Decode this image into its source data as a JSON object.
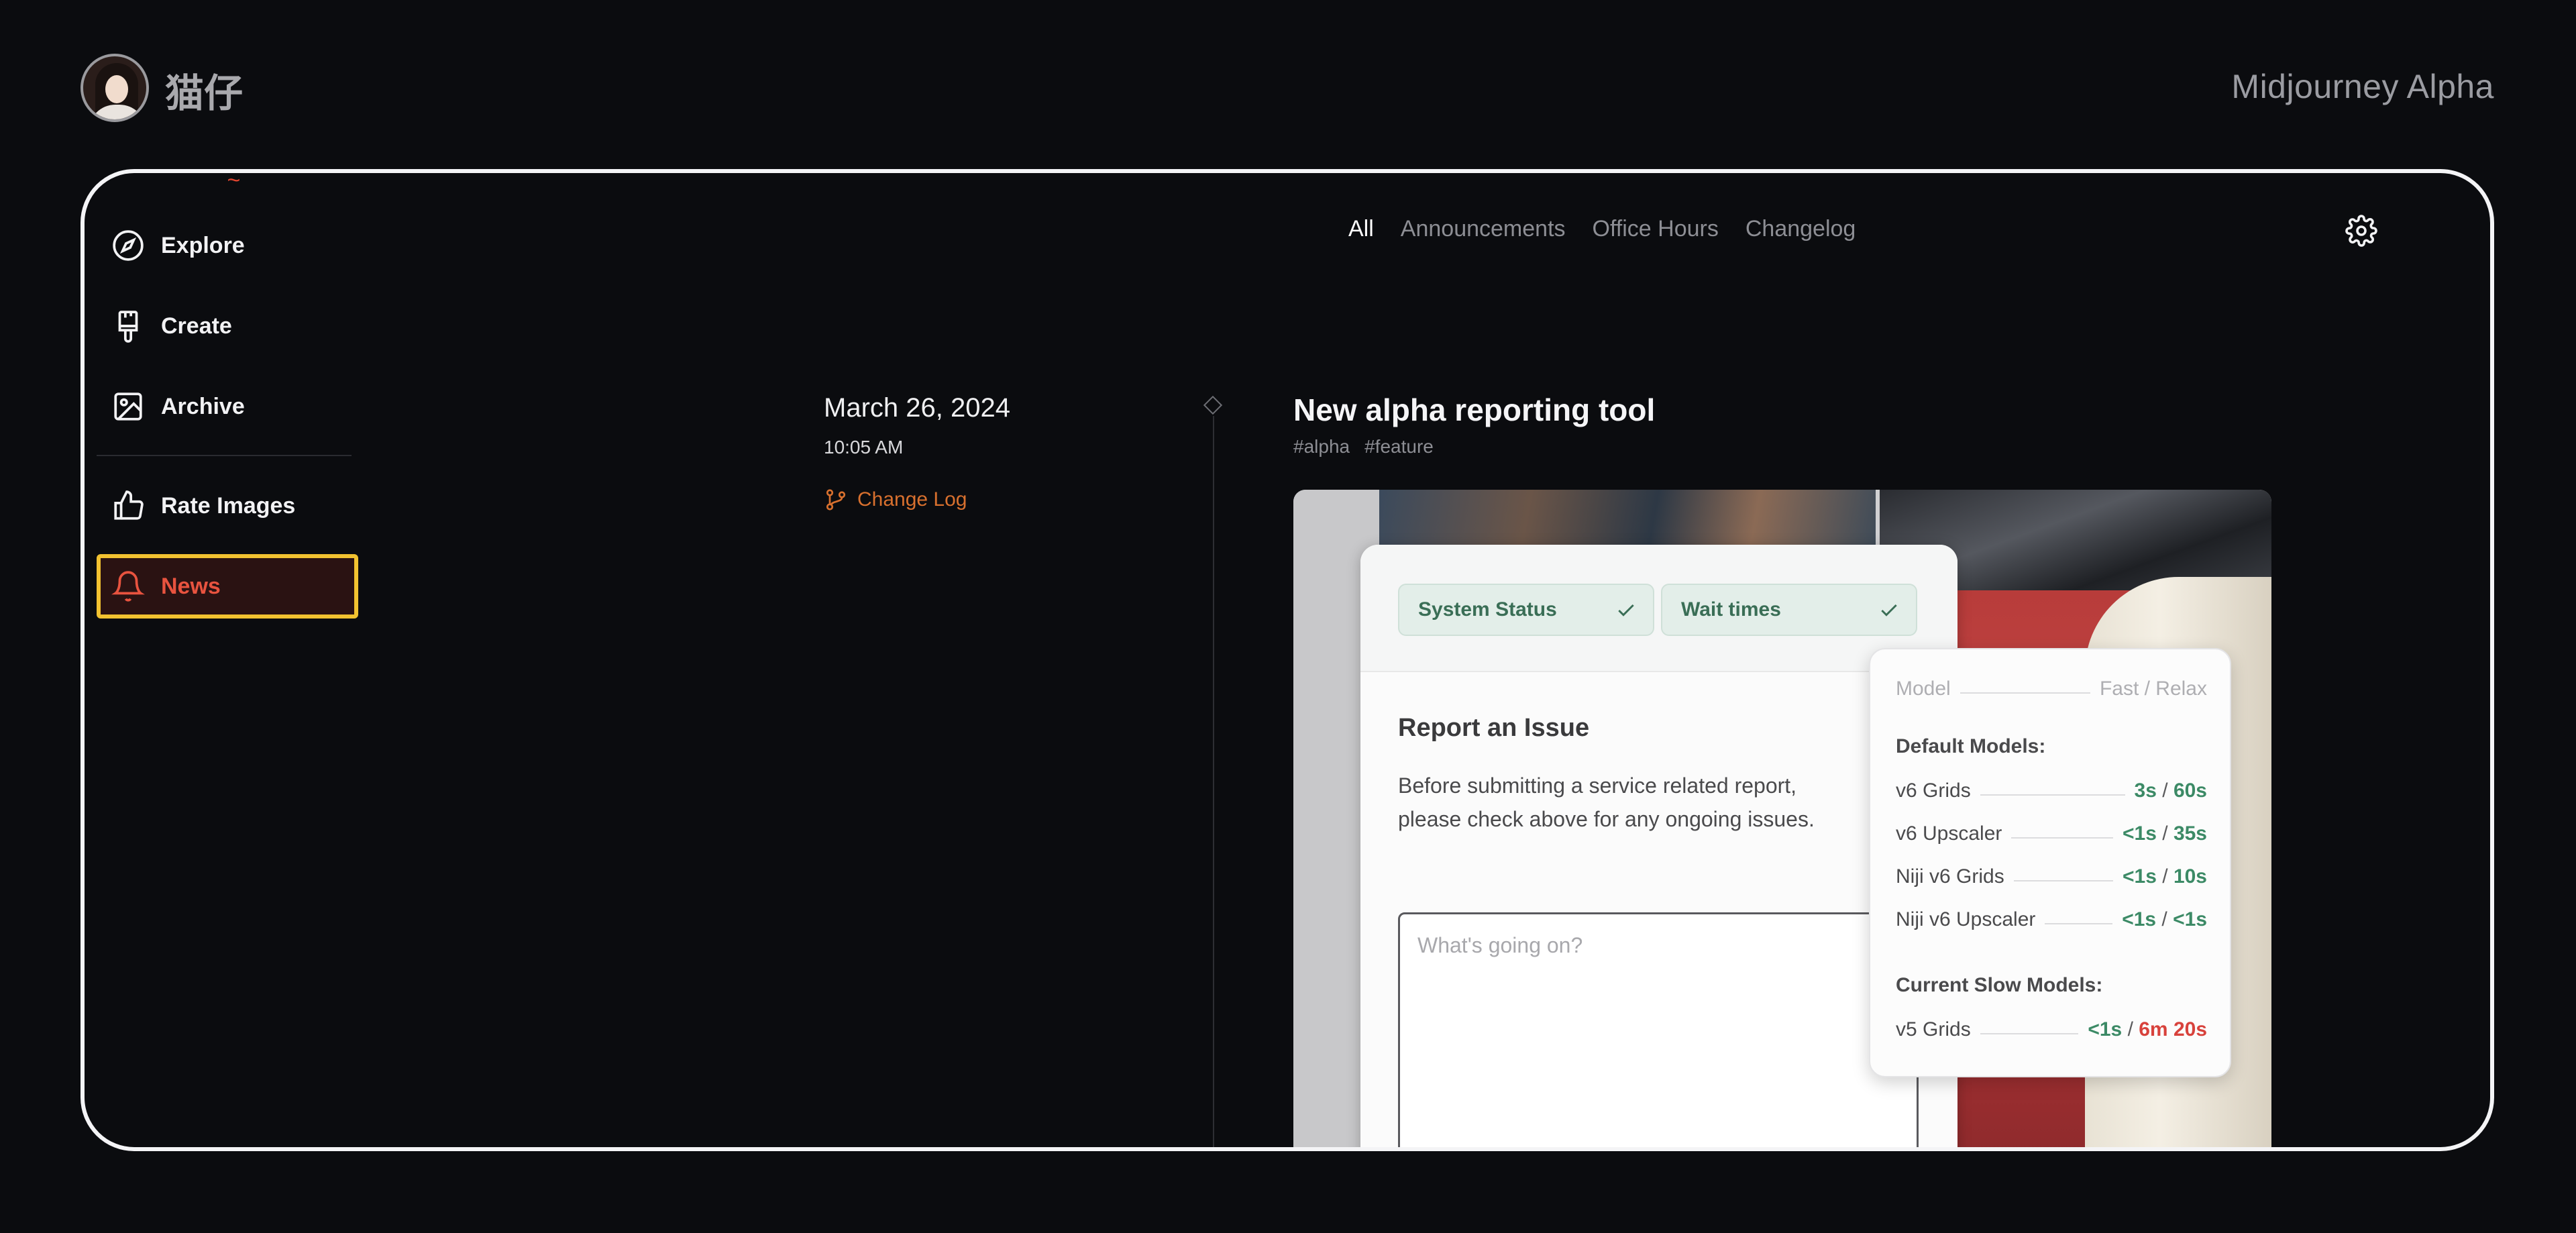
{
  "header": {
    "username": "猫仔",
    "brand": "Midjourney Alpha"
  },
  "sidebar": {
    "items": [
      {
        "label": "Explore",
        "icon": "compass-icon"
      },
      {
        "label": "Create",
        "icon": "paintbrush-icon"
      },
      {
        "label": "Archive",
        "icon": "image-icon"
      },
      {
        "label": "Rate Images",
        "icon": "thumbs-up-icon"
      },
      {
        "label": "News",
        "icon": "bell-icon",
        "active": true
      }
    ]
  },
  "tabs": [
    {
      "label": "All",
      "active": true
    },
    {
      "label": "Announcements"
    },
    {
      "label": "Office Hours"
    },
    {
      "label": "Changelog"
    }
  ],
  "post": {
    "date": "March 26, 2024",
    "time": "10:05 AM",
    "category": "Change Log",
    "title": "New alpha reporting tool",
    "tags": [
      "#alpha",
      "#feature"
    ]
  },
  "screenshot": {
    "pills": [
      "System Status",
      "Wait times"
    ],
    "report_title": "Report an Issue",
    "report_desc": "Before submitting a service related report, please check above for any ongoing issues.",
    "input_placeholder": "What's going on?",
    "popover": {
      "header_left": "Model",
      "header_right": "Fast / Relax",
      "default_label": "Default Models:",
      "default_models": [
        {
          "name": "v6 Grids",
          "fast": "3s",
          "relax": "60s"
        },
        {
          "name": "v6 Upscaler",
          "fast": "<1s",
          "relax": "35s"
        },
        {
          "name": "Niji v6 Grids",
          "fast": "<1s",
          "relax": "10s"
        },
        {
          "name": "Niji v6 Upscaler",
          "fast": "<1s",
          "relax": "<1s"
        }
      ],
      "slow_label": "Current Slow Models:",
      "slow_models": [
        {
          "name": "v5 Grids",
          "fast": "<1s",
          "relax": "6m 20s"
        }
      ]
    }
  },
  "colors": {
    "accent_active": "#e8533f",
    "highlight_border": "#f2c230",
    "link": "#d8702e",
    "ok_green": "#3c8a66",
    "slow_red": "#d8423c"
  }
}
